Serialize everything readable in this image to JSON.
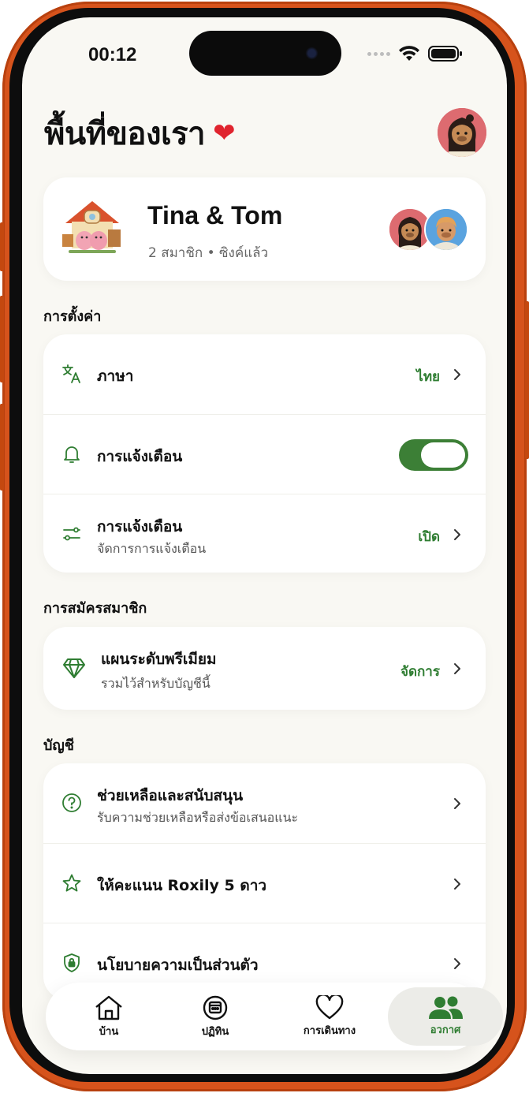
{
  "status_bar": {
    "time": "00:12"
  },
  "header": {
    "title": "พื้นที่ของเรา"
  },
  "group": {
    "name": "Tina & Tom",
    "meta": "2 สมาชิก • ซิงค์แล้ว"
  },
  "sections": {
    "settings": "การตั้งค่า",
    "subscription": "การสมัครสมาชิก",
    "account": "บัญชี"
  },
  "settings": {
    "language": {
      "title": "ภาษา",
      "value": "ไทย"
    },
    "notifications_toggle": {
      "title": "การแจ้งเตือน",
      "enabled": true
    },
    "notifications_manage": {
      "title": "การแจ้งเตือน",
      "subtitle": "จัดการการแจ้งเตือน",
      "value": "เปิด"
    }
  },
  "subscription": {
    "premium": {
      "title": "แผนระดับพรีเมียม",
      "subtitle": "รวมไว้สำหรับบัญชีนี้",
      "value": "จัดการ"
    }
  },
  "account": {
    "support": {
      "title": "ช่วยเหลือและสนับสนุน",
      "subtitle": "รับความช่วยเหลือหรือส่งข้อเสนอแนะ"
    },
    "rate": {
      "title": "ให้คะแนน Roxily 5 ดาว"
    },
    "privacy": {
      "title": "นโยบายความเป็นส่วนตัว"
    }
  },
  "tabs": [
    {
      "label": "บ้าน",
      "icon": "home-icon"
    },
    {
      "label": "ปฏิทิน",
      "icon": "calendar-icon"
    },
    {
      "label": "การเดินทาง",
      "icon": "heart-icon"
    },
    {
      "label": "อวกาศ",
      "icon": "people-icon",
      "active": true
    }
  ],
  "colors": {
    "accent_green": "#2f7d32",
    "toggle_green": "#3c7f36",
    "frame_orange": "#d6531c",
    "background": "#f9f8f3"
  }
}
